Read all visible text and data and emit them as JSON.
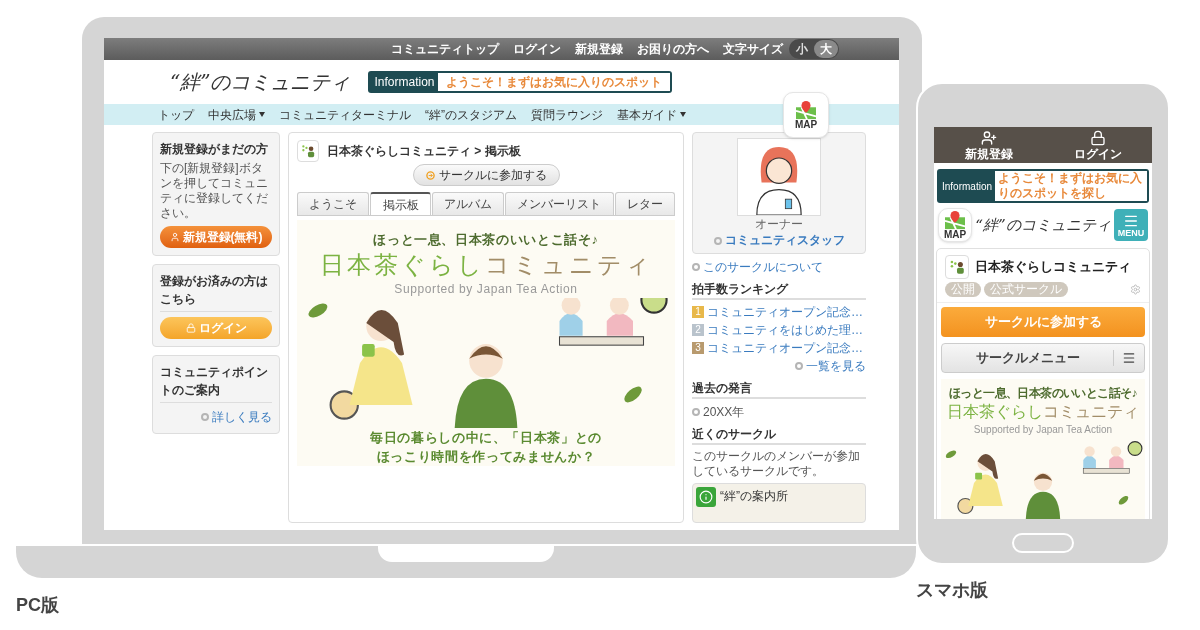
{
  "pc": {
    "caption": "PC版",
    "utility_links": [
      "コミュニティトップ",
      "ログイン",
      "新規登録",
      "お困りの方へ"
    ],
    "font_size": {
      "label": "文字サイズ",
      "options": [
        {
          "label": "小",
          "selected": false
        },
        {
          "label": "大",
          "selected": true
        }
      ]
    },
    "logo": "“絆”のコミュニティ",
    "info": {
      "label": "Information",
      "text": "ようこそ！まずはお気に入りのスポット"
    },
    "map_button": "MAP",
    "nav": [
      {
        "label": "トップ",
        "dropdown": false
      },
      {
        "label": "中央広場",
        "dropdown": true
      },
      {
        "label": "コミュニティターミナル",
        "dropdown": false
      },
      {
        "label": "“絆”のスタジアム",
        "dropdown": false
      },
      {
        "label": "質問ラウンジ",
        "dropdown": false
      },
      {
        "label": "基本ガイド",
        "dropdown": true
      }
    ],
    "left": {
      "signup": {
        "title": "新規登録がまだの方",
        "text": "下の[新規登録]ボタンを押してコミュニティに登録してください。",
        "button": "新規登録(無料)"
      },
      "login": {
        "title": "登録がお済みの方はこちら",
        "button": "ログイン"
      },
      "points": {
        "title": "コミュニティポイントのご案内",
        "link": "詳しく見る"
      }
    },
    "center": {
      "breadcrumb": "日本茶ぐらしコミュニティ > 掲示板",
      "join": "サークルに参加する",
      "tabs": [
        {
          "label": "ようこそ",
          "selected": false
        },
        {
          "label": "掲示板",
          "selected": true
        },
        {
          "label": "アルバム",
          "selected": false
        },
        {
          "label": "メンバーリスト",
          "selected": false
        },
        {
          "label": "レター",
          "selected": false
        }
      ],
      "banner": {
        "tagline": "ほっと一息、日本茶のいいとこ話そ♪",
        "title_green": "日本茶ぐらし",
        "title_brown": "コミュニティ",
        "supported": "Supported by Japan Tea Action",
        "message": [
          "毎日の暮らしの中に、「日本茶」との",
          "ほっこり時間を作ってみませんか？"
        ]
      }
    },
    "right": {
      "owner_role": "オーナー",
      "owner_name": "コミュニティスタッフ",
      "about": "このサークルについて",
      "ranking": {
        "title": "拍手数ランキング",
        "items": [
          {
            "rank": "1",
            "title": "コミュニティオープン記念…",
            "color": "#e8b84a"
          },
          {
            "rank": "2",
            "title": "コミュニティをはじめた理…",
            "color": "#b9c3cc"
          },
          {
            "rank": "3",
            "title": "コミュニティオープン記念…",
            "color": "#b89a6e"
          }
        ],
        "more": "一覧を見る"
      },
      "past": {
        "title": "過去の発言",
        "items": [
          "20XX年"
        ]
      },
      "nearby": {
        "title": "近くのサークル",
        "text": "このサークルのメンバーが参加しているサークルです。",
        "items": [
          {
            "name": "“絆”の案内所"
          }
        ]
      }
    }
  },
  "sp": {
    "caption": "スマホ版",
    "top_actions": [
      {
        "label": "新規登録",
        "kind": "signup"
      },
      {
        "label": "ログイン",
        "kind": "login"
      }
    ],
    "info": {
      "label": "Information",
      "text": "ようこそ！まずはお気に入りのスポットを探し"
    },
    "map_button": "MAP",
    "logo": "“絆”のコミュニティ",
    "menu_button": "MENU",
    "community": {
      "name": "日本茶ぐらしコミュニティ",
      "tags": [
        "公開",
        "公式サークル"
      ],
      "join": "サークルに参加する",
      "menu": "サークルメニュー"
    },
    "banner": {
      "tagline": "ほっと一息、日本茶のいいとこ話そ♪",
      "title_green": "日本茶ぐらし",
      "title_brown": "コミュニティ",
      "supported": "Supported by Japan Tea Action"
    }
  }
}
